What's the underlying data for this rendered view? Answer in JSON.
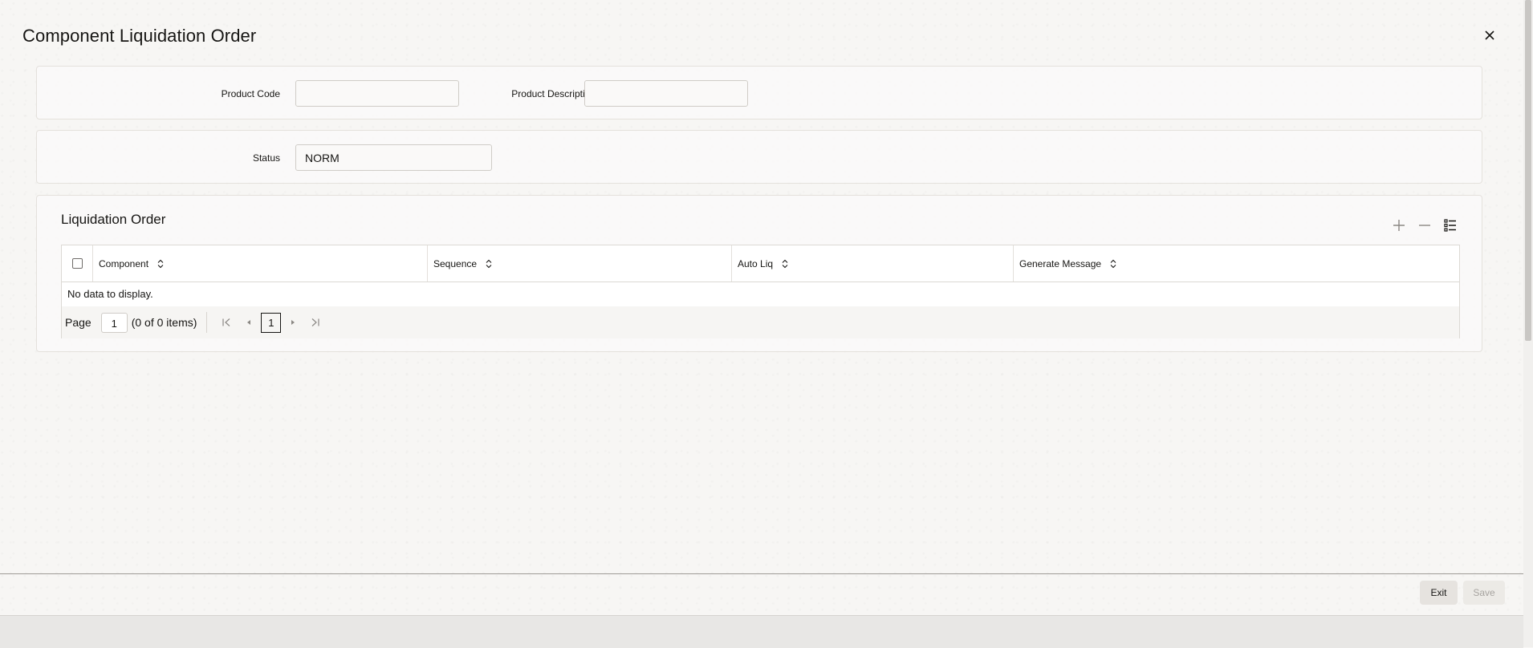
{
  "window": {
    "title": "Component Liquidation Order"
  },
  "header_panel": {
    "product_code_label": "Product Code",
    "product_code_value": "",
    "product_description_label": "Product Description",
    "product_description_value": ""
  },
  "status_panel": {
    "status_label": "Status",
    "status_value": "NORM"
  },
  "liquidation_order": {
    "title": "Liquidation Order",
    "toolbar": {
      "add_icon": "plus-icon",
      "remove_icon": "minus-icon",
      "columns_icon": "list-settings-icon"
    },
    "columns": [
      "Component",
      "Sequence",
      "Auto Liq",
      "Generate Message"
    ],
    "rows": [],
    "empty_message": "No data to display.",
    "pager": {
      "page_label": "Page",
      "page_value": "1",
      "items_text": "(0 of 0 items)",
      "current_page": "1"
    }
  },
  "footer": {
    "exit_label": "Exit",
    "save_label": "Save"
  }
}
